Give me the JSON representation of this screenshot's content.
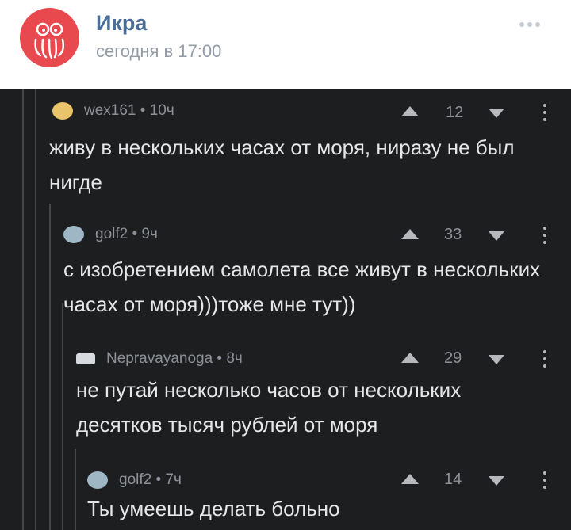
{
  "post": {
    "group_name": "Икра",
    "time": "сегодня в 17:00"
  },
  "comments": [
    {
      "author_meta": "wex161 • 10ч",
      "rating": "12",
      "text": "живу в нескольких часах от моря, ниразу не был нигде",
      "avatar_color": "#e9c46a"
    },
    {
      "author_meta": "golf2 • 9ч",
      "rating": "33",
      "text": "с изобретением самолета все живут в нескольких часах от моря)))тоже мне тут))",
      "avatar_color": "#9fb7c4"
    },
    {
      "author_meta": "Nepravayanoga • 8ч",
      "rating": "29",
      "text": "не путай несколько часов от нескольких десятков тысяч рублей от моря",
      "avatar_color": "#d7dbe0"
    },
    {
      "author_meta": "golf2 • 7ч",
      "rating": "14",
      "text": "Ты умеешь делать больно",
      "avatar_color": "#9fb7c4"
    }
  ],
  "colors": {
    "brand": "#4a6e98",
    "avatar_bg": "#e8494f",
    "dark_bg": "#1d1e20"
  }
}
